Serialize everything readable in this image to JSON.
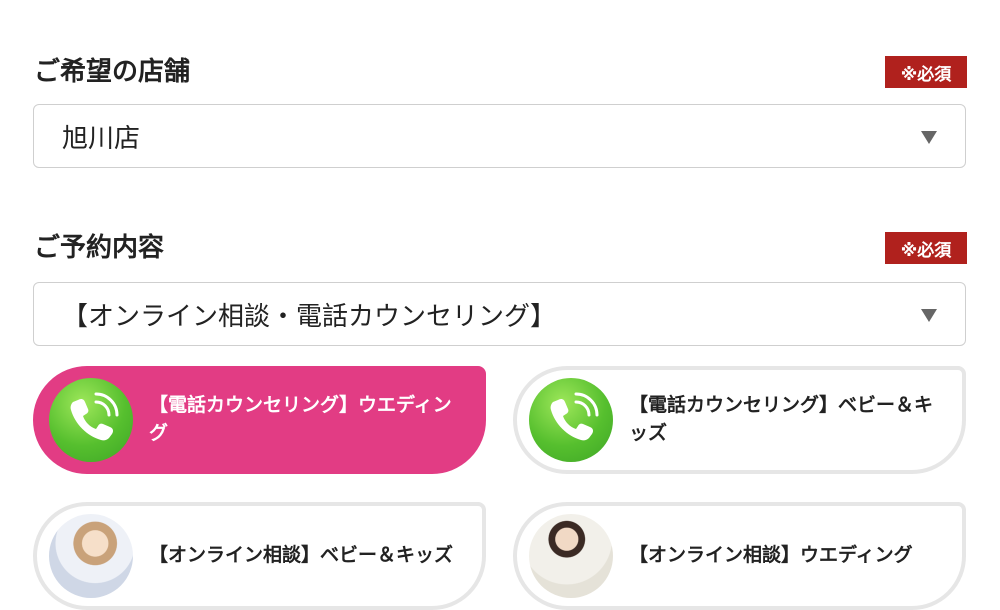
{
  "store": {
    "label": "ご希望の店舗",
    "required": "※必須",
    "selected": "旭川店"
  },
  "reservation": {
    "label": "ご予約内容",
    "required": "※必須",
    "selected": "【オンライン相談・電話カウンセリング】"
  },
  "options": [
    {
      "label": "【電話カウンセリング】ウエディング",
      "icon": "phone-icon",
      "selected": true
    },
    {
      "label": "【電話カウンセリング】ベビー＆キッズ",
      "icon": "phone-icon",
      "selected": false
    },
    {
      "label": "【オンライン相談】ベビー＆キッズ",
      "icon": "photo-thumbnail",
      "selected": false
    },
    {
      "label": "【オンライン相談】ウエディング",
      "icon": "photo-thumbnail",
      "selected": false
    }
  ],
  "colors": {
    "required_badge": "#b0211d",
    "selected_option": "#e23c84",
    "phone_icon": "#56bf2e"
  }
}
